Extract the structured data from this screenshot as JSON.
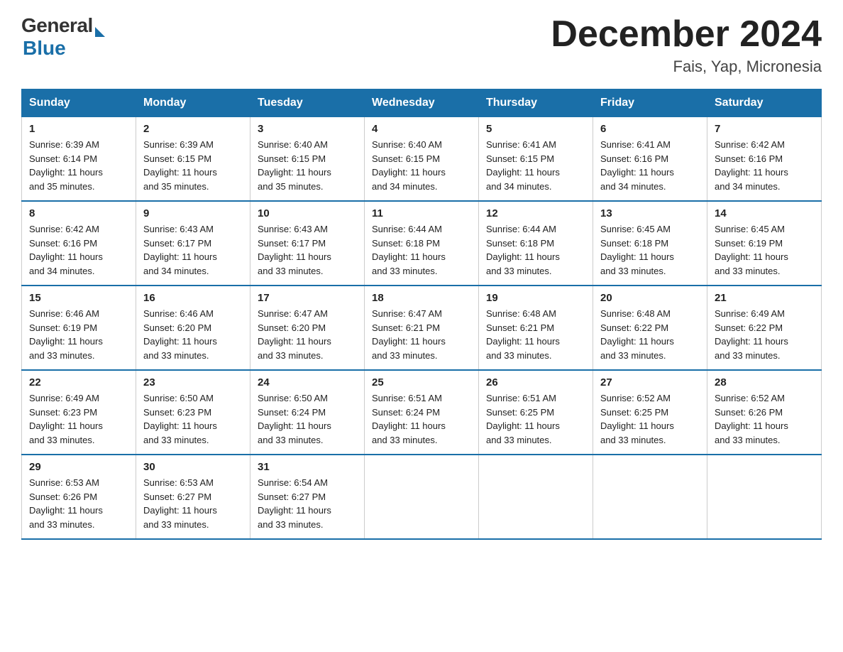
{
  "header": {
    "logo_general": "General",
    "logo_blue": "Blue",
    "month_title": "December 2024",
    "location": "Fais, Yap, Micronesia"
  },
  "days_of_week": [
    "Sunday",
    "Monday",
    "Tuesday",
    "Wednesday",
    "Thursday",
    "Friday",
    "Saturday"
  ],
  "weeks": [
    [
      {
        "day": "1",
        "sunrise": "6:39 AM",
        "sunset": "6:14 PM",
        "daylight": "11 hours and 35 minutes."
      },
      {
        "day": "2",
        "sunrise": "6:39 AM",
        "sunset": "6:15 PM",
        "daylight": "11 hours and 35 minutes."
      },
      {
        "day": "3",
        "sunrise": "6:40 AM",
        "sunset": "6:15 PM",
        "daylight": "11 hours and 35 minutes."
      },
      {
        "day": "4",
        "sunrise": "6:40 AM",
        "sunset": "6:15 PM",
        "daylight": "11 hours and 34 minutes."
      },
      {
        "day": "5",
        "sunrise": "6:41 AM",
        "sunset": "6:15 PM",
        "daylight": "11 hours and 34 minutes."
      },
      {
        "day": "6",
        "sunrise": "6:41 AM",
        "sunset": "6:16 PM",
        "daylight": "11 hours and 34 minutes."
      },
      {
        "day": "7",
        "sunrise": "6:42 AM",
        "sunset": "6:16 PM",
        "daylight": "11 hours and 34 minutes."
      }
    ],
    [
      {
        "day": "8",
        "sunrise": "6:42 AM",
        "sunset": "6:16 PM",
        "daylight": "11 hours and 34 minutes."
      },
      {
        "day": "9",
        "sunrise": "6:43 AM",
        "sunset": "6:17 PM",
        "daylight": "11 hours and 34 minutes."
      },
      {
        "day": "10",
        "sunrise": "6:43 AM",
        "sunset": "6:17 PM",
        "daylight": "11 hours and 33 minutes."
      },
      {
        "day": "11",
        "sunrise": "6:44 AM",
        "sunset": "6:18 PM",
        "daylight": "11 hours and 33 minutes."
      },
      {
        "day": "12",
        "sunrise": "6:44 AM",
        "sunset": "6:18 PM",
        "daylight": "11 hours and 33 minutes."
      },
      {
        "day": "13",
        "sunrise": "6:45 AM",
        "sunset": "6:18 PM",
        "daylight": "11 hours and 33 minutes."
      },
      {
        "day": "14",
        "sunrise": "6:45 AM",
        "sunset": "6:19 PM",
        "daylight": "11 hours and 33 minutes."
      }
    ],
    [
      {
        "day": "15",
        "sunrise": "6:46 AM",
        "sunset": "6:19 PM",
        "daylight": "11 hours and 33 minutes."
      },
      {
        "day": "16",
        "sunrise": "6:46 AM",
        "sunset": "6:20 PM",
        "daylight": "11 hours and 33 minutes."
      },
      {
        "day": "17",
        "sunrise": "6:47 AM",
        "sunset": "6:20 PM",
        "daylight": "11 hours and 33 minutes."
      },
      {
        "day": "18",
        "sunrise": "6:47 AM",
        "sunset": "6:21 PM",
        "daylight": "11 hours and 33 minutes."
      },
      {
        "day": "19",
        "sunrise": "6:48 AM",
        "sunset": "6:21 PM",
        "daylight": "11 hours and 33 minutes."
      },
      {
        "day": "20",
        "sunrise": "6:48 AM",
        "sunset": "6:22 PM",
        "daylight": "11 hours and 33 minutes."
      },
      {
        "day": "21",
        "sunrise": "6:49 AM",
        "sunset": "6:22 PM",
        "daylight": "11 hours and 33 minutes."
      }
    ],
    [
      {
        "day": "22",
        "sunrise": "6:49 AM",
        "sunset": "6:23 PM",
        "daylight": "11 hours and 33 minutes."
      },
      {
        "day": "23",
        "sunrise": "6:50 AM",
        "sunset": "6:23 PM",
        "daylight": "11 hours and 33 minutes."
      },
      {
        "day": "24",
        "sunrise": "6:50 AM",
        "sunset": "6:24 PM",
        "daylight": "11 hours and 33 minutes."
      },
      {
        "day": "25",
        "sunrise": "6:51 AM",
        "sunset": "6:24 PM",
        "daylight": "11 hours and 33 minutes."
      },
      {
        "day": "26",
        "sunrise": "6:51 AM",
        "sunset": "6:25 PM",
        "daylight": "11 hours and 33 minutes."
      },
      {
        "day": "27",
        "sunrise": "6:52 AM",
        "sunset": "6:25 PM",
        "daylight": "11 hours and 33 minutes."
      },
      {
        "day": "28",
        "sunrise": "6:52 AM",
        "sunset": "6:26 PM",
        "daylight": "11 hours and 33 minutes."
      }
    ],
    [
      {
        "day": "29",
        "sunrise": "6:53 AM",
        "sunset": "6:26 PM",
        "daylight": "11 hours and 33 minutes."
      },
      {
        "day": "30",
        "sunrise": "6:53 AM",
        "sunset": "6:27 PM",
        "daylight": "11 hours and 33 minutes."
      },
      {
        "day": "31",
        "sunrise": "6:54 AM",
        "sunset": "6:27 PM",
        "daylight": "11 hours and 33 minutes."
      },
      null,
      null,
      null,
      null
    ]
  ],
  "labels": {
    "sunrise": "Sunrise:",
    "sunset": "Sunset:",
    "daylight": "Daylight:"
  }
}
